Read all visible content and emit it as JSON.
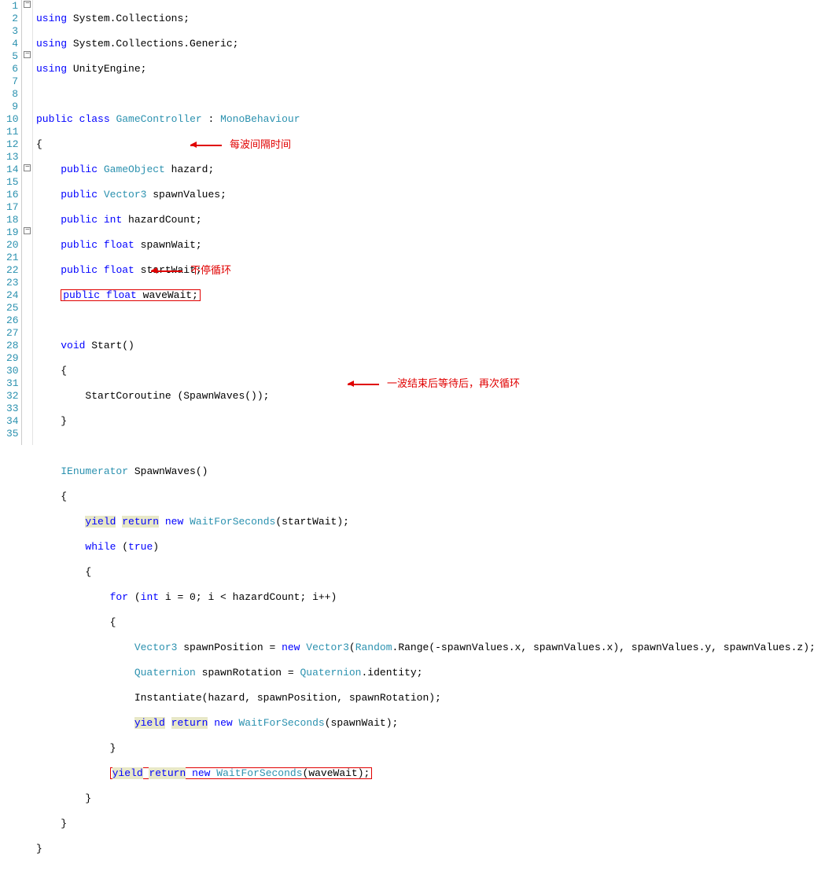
{
  "gutter": [
    "1",
    "2",
    "3",
    "4",
    "5",
    "6",
    "7",
    "8",
    "9",
    "10",
    "11",
    "12",
    "13",
    "14",
    "15",
    "16",
    "17",
    "18",
    "19",
    "20",
    "21",
    "22",
    "23",
    "24",
    "25",
    "26",
    "27",
    "28",
    "29",
    "30",
    "31",
    "32",
    "33",
    "34",
    "35"
  ],
  "fold": {
    "l1": "-",
    "l5": "-",
    "l14": "-",
    "l19": "-"
  },
  "code": {
    "l1": {
      "kw": "using",
      "rest": " System.Collections;"
    },
    "l2": {
      "kw": "using",
      "rest": " System.Collections.Generic;"
    },
    "l3": {
      "kw": "using",
      "rest": " UnityEngine;"
    },
    "l5a": {
      "kw1": "public",
      "kw2": "class",
      "name": "GameController",
      "colon": " : ",
      "base": "MonoBehaviour"
    },
    "l6": "{",
    "l7": {
      "kw1": "public",
      "type": "GameObject",
      "name": " hazard;"
    },
    "l8": {
      "kw1": "public",
      "type": "Vector3",
      "name": " spawnValues;"
    },
    "l9": {
      "kw1": "public",
      "kw2": "int",
      "name": " hazardCount;"
    },
    "l10": {
      "kw1": "public",
      "kw2": "float",
      "name": " spawnWait;"
    },
    "l11": {
      "kw1": "public",
      "kw2": "float",
      "name": " startWait;"
    },
    "l12": {
      "kw1": "public",
      "kw2": "float",
      "name": " waveWait;"
    },
    "l14": {
      "kw": "void",
      "name": " Start()"
    },
    "l15": "{",
    "l16": "StartCoroutine (SpawnWaves());",
    "l17": "}",
    "l19": {
      "type": "IEnumerator",
      "name": " SpawnWaves()"
    },
    "l20": "{",
    "l21": {
      "y": "yield",
      "r": "return",
      "n": "new",
      "t": "WaitForSeconds",
      "args": "(startWait);"
    },
    "l22": {
      "kw": "while",
      "paren": " (",
      "val": "true",
      "close": ")"
    },
    "l23": "{",
    "l24": {
      "kw": "for",
      "rest1": " (",
      "kw2": "int",
      "rest2": " i = 0; i < hazardCount; i++)"
    },
    "l25": "{",
    "l26": {
      "type": "Vector3",
      "rest1": " spawnPosition = ",
      "kw": "new",
      "type2": "Vector3",
      "rest2": "(",
      "type3": "Random",
      "rest3": ".Range(-spawnValues.x, spawnValues.x), spawnValues.y, spawnValues.z);"
    },
    "l27": {
      "type": "Quaternion",
      "rest1": " spawnRotation = ",
      "type2": "Quaternion",
      "rest2": ".identity;"
    },
    "l28": "Instantiate(hazard, spawnPosition, spawnRotation);",
    "l29": {
      "y": "yield",
      "r": "return",
      "n": "new",
      "t": "WaitForSeconds",
      "args": "(spawnWait);"
    },
    "l30": "}",
    "l31": {
      "y": "yield",
      "r": "return",
      "n": "new",
      "t": "WaitForSeconds",
      "args": "(waveWait);"
    },
    "l32": "}",
    "l33": "}",
    "l34": "}"
  },
  "annotations": {
    "a1": "每波间隔时间",
    "a2": "不停循环",
    "a3": "一波结束后等待后，再次循环"
  }
}
